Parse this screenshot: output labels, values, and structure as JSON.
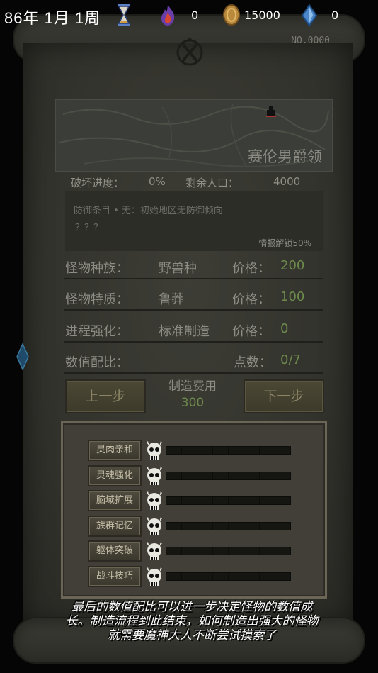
{
  "topbar": {
    "date": "86年 1月 1周",
    "souls": "0",
    "gold": "15000",
    "crystals": "0"
  },
  "scroll": {
    "serial": "NO.0000",
    "territory": "赛伦男爵领"
  },
  "stats": {
    "destroy_label": "破坏进度：",
    "destroy_value": "0%",
    "population_label": "剩余人口：",
    "population_value": "4000"
  },
  "defense": {
    "line1": "防御条目 • 无：初始地区无防御倾向",
    "line2": "？？？",
    "unlock": "情报解锁50%"
  },
  "properties": [
    {
      "label": "怪物种族：",
      "value": "野兽种",
      "price_label": "价格：",
      "price": "200"
    },
    {
      "label": "怪物特质：",
      "value": "鲁莽",
      "price_label": "价格：",
      "price": "100"
    },
    {
      "label": "进程强化：",
      "value": "标准制造",
      "price_label": "价格：",
      "price": "0"
    },
    {
      "label": "数值配比：",
      "value": "",
      "price_label": "点数：",
      "price": "0/7"
    }
  ],
  "actions": {
    "prev_label": "上一步",
    "next_label": "下一步",
    "fee_label": "制造费用",
    "fee_value": "300"
  },
  "skills": [
    {
      "label": "灵肉亲和",
      "points": 0,
      "max": 8
    },
    {
      "label": "灵魂强化",
      "points": 0,
      "max": 8
    },
    {
      "label": "脑域扩展",
      "points": 0,
      "max": 8
    },
    {
      "label": "族群记忆",
      "points": 0,
      "max": 8
    },
    {
      "label": "躯体突破",
      "points": 0,
      "max": 8
    },
    {
      "label": "战斗技巧",
      "points": 0,
      "max": 8
    }
  ],
  "tutorial": {
    "text": "最后的数值配比可以进一步决定怪物的数值成长。制造流程到此结束，如何制造出强大的怪物就需要魔神大人不断尝试摸索了"
  },
  "colors": {
    "accent_green": "#6d8a4c",
    "parchment": "#3d3d36"
  }
}
